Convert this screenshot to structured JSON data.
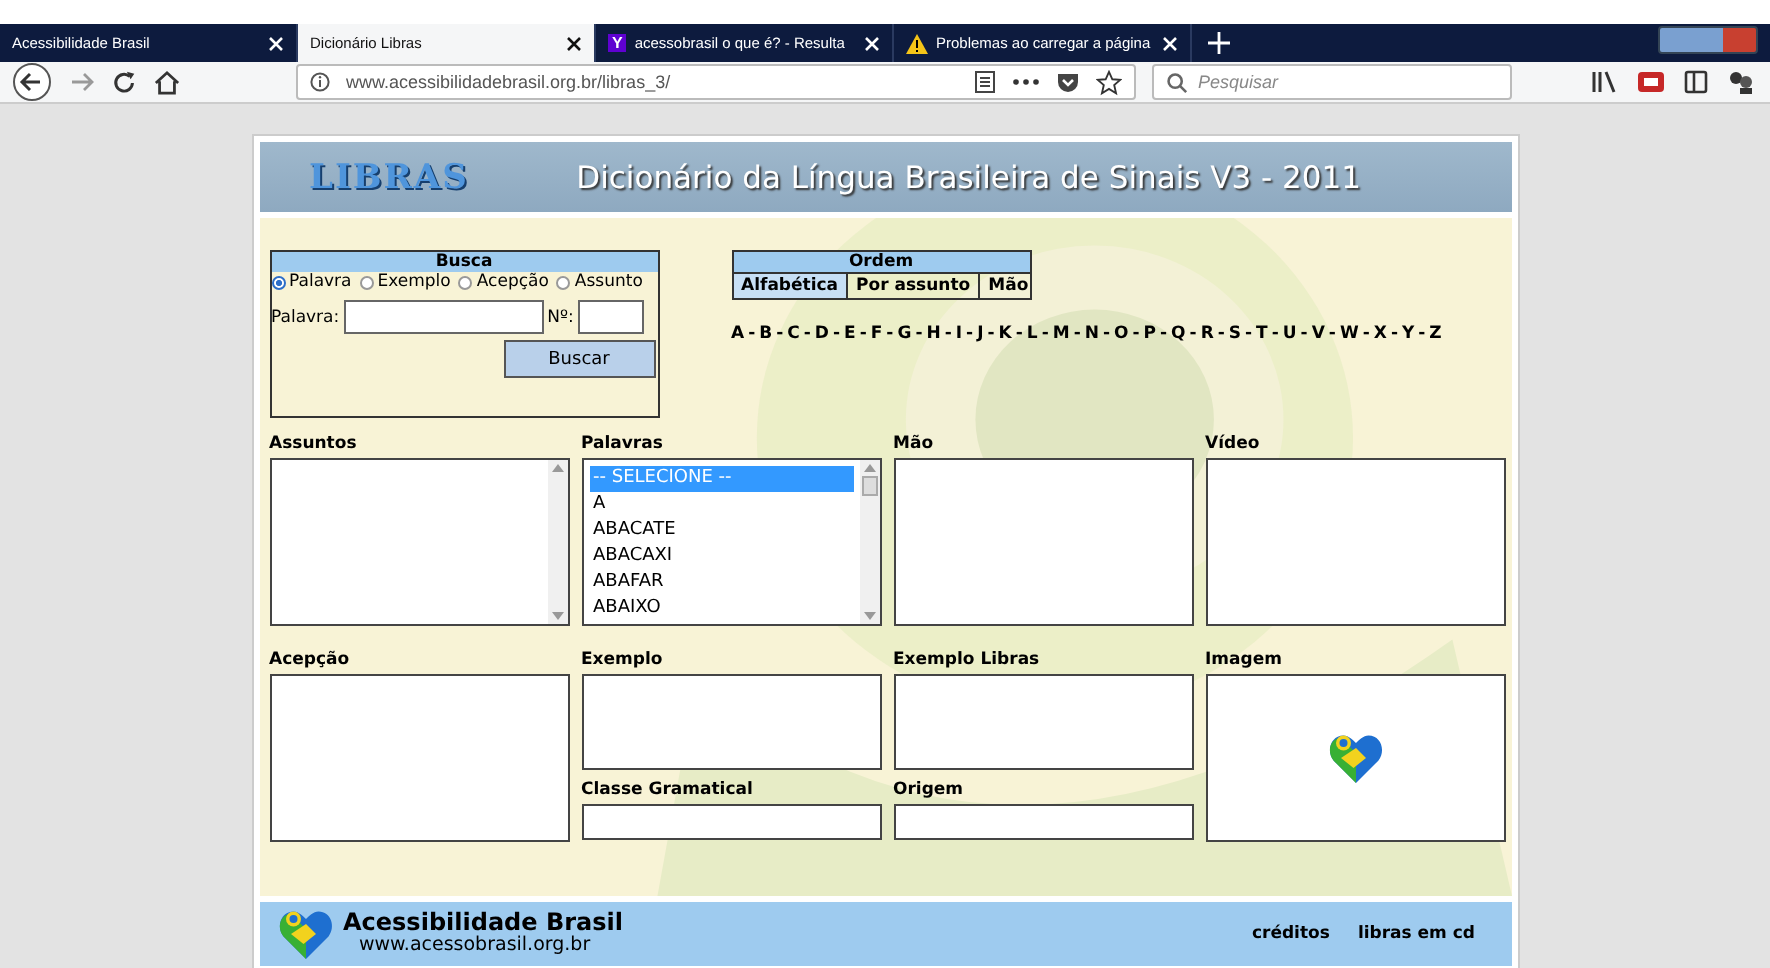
{
  "browser": {
    "tabs": [
      {
        "title": "Acessibilidade Brasil",
        "selected": false,
        "kind": "plain"
      },
      {
        "title": "Dicionário Libras",
        "selected": true,
        "kind": "plain"
      },
      {
        "title": "acessobrasil o que é? - Resulta",
        "selected": false,
        "kind": "yahoo",
        "badge": "Y"
      },
      {
        "title": "Problemas ao carregar a página",
        "selected": false,
        "kind": "warning"
      }
    ],
    "url": "www.acessibilidadebrasil.org.br/libras_3/",
    "search": {
      "placeholder": "Pesquisar"
    }
  },
  "header": {
    "logo": "LIBRAS",
    "title": "Dicionário da Língua Brasileira de Sinais V3 - 2011"
  },
  "busca": {
    "title": "Busca",
    "options": [
      {
        "label": "Palavra",
        "selected": true
      },
      {
        "label": "Exemplo",
        "selected": false
      },
      {
        "label": "Acepção",
        "selected": false
      },
      {
        "label": "Assunto",
        "selected": false
      }
    ],
    "word_label": "Palavra:",
    "number_label": "Nº:",
    "button": "Buscar"
  },
  "ordem": {
    "title": "Ordem",
    "tabs": [
      "Alfabética",
      "Por assunto",
      "Mão"
    ]
  },
  "letter_separator": "-",
  "letters": [
    "A",
    "B",
    "C",
    "D",
    "E",
    "F",
    "G",
    "H",
    "I",
    "J",
    "K",
    "L",
    "M",
    "N",
    "O",
    "P",
    "Q",
    "R",
    "S",
    "T",
    "U",
    "V",
    "W",
    "X",
    "Y",
    "Z"
  ],
  "assuntos": {
    "label": "Assuntos"
  },
  "palavras": {
    "label": "Palavras",
    "items": [
      {
        "text": "-- SELECIONE --",
        "selected": true
      },
      {
        "text": "A",
        "selected": false
      },
      {
        "text": "ABACATE",
        "selected": false
      },
      {
        "text": "ABACAXI",
        "selected": false
      },
      {
        "text": "ABAFAR",
        "selected": false
      },
      {
        "text": "ABAIXO",
        "selected": false
      }
    ]
  },
  "mao": {
    "label": "Mão"
  },
  "video": {
    "label": "Vídeo"
  },
  "acepcao": {
    "label": "Acepção"
  },
  "exemplo": {
    "label": "Exemplo"
  },
  "exemplo_libras": {
    "label": "Exemplo Libras"
  },
  "imagem": {
    "label": "Imagem"
  },
  "classe": {
    "label": "Classe Gramatical"
  },
  "origem": {
    "label": "Origem"
  },
  "footer": {
    "name": "Acessibilidade Brasil",
    "site": "www.acessobrasil.org.br",
    "links": [
      "créditos",
      "libras em cd"
    ]
  }
}
